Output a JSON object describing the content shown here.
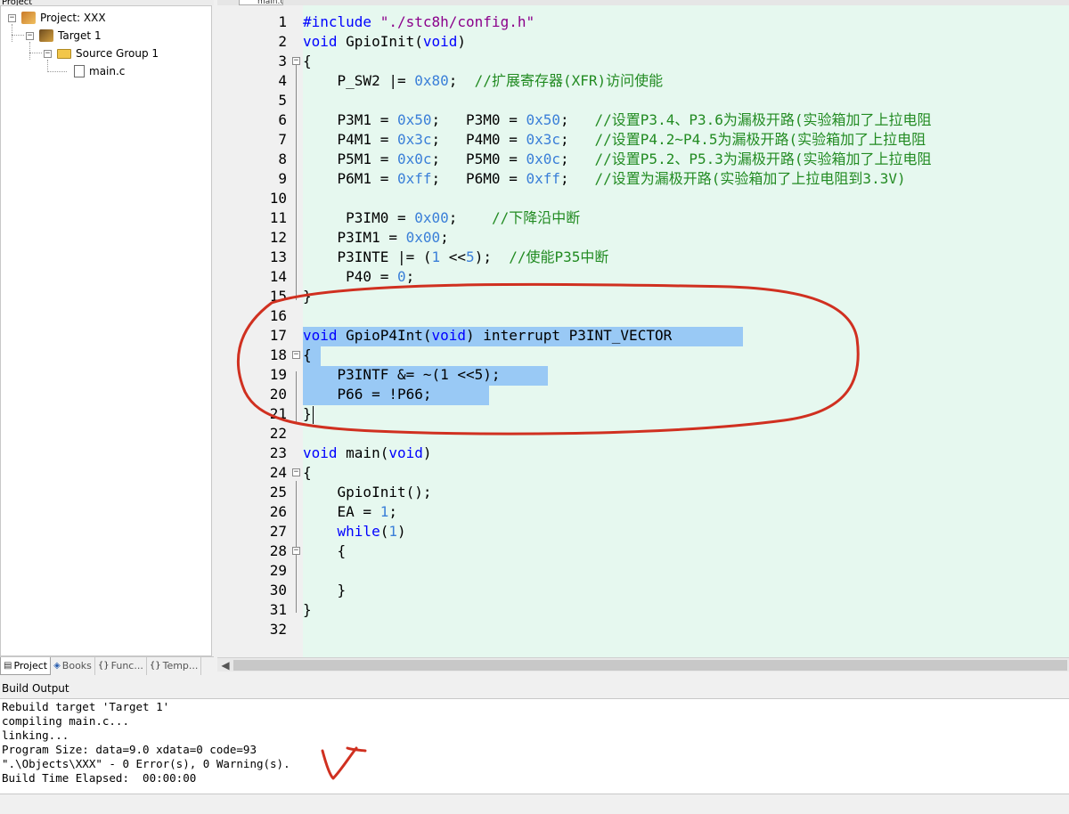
{
  "project_panel": {
    "header": "Project",
    "tree": {
      "project": "Project: XXX",
      "target": "Target 1",
      "group": "Source Group 1",
      "file": "main.c"
    },
    "tabs": [
      {
        "label": "Project",
        "icon": "project-icon"
      },
      {
        "label": "Books",
        "icon": "books-icon"
      },
      {
        "label": "Func...",
        "icon": "functions-icon"
      },
      {
        "label": "Temp...",
        "icon": "templates-icon"
      }
    ]
  },
  "editor": {
    "tab_label": "main.c",
    "lines": [
      {
        "n": "1"
      },
      {
        "n": "2"
      },
      {
        "n": "3"
      },
      {
        "n": "4"
      },
      {
        "n": "5"
      },
      {
        "n": "6"
      },
      {
        "n": "7"
      },
      {
        "n": "8"
      },
      {
        "n": "9"
      },
      {
        "n": "10"
      },
      {
        "n": "11"
      },
      {
        "n": "12"
      },
      {
        "n": "13"
      },
      {
        "n": "14"
      },
      {
        "n": "15"
      },
      {
        "n": "16"
      },
      {
        "n": "17"
      },
      {
        "n": "18"
      },
      {
        "n": "19"
      },
      {
        "n": "20"
      },
      {
        "n": "21"
      },
      {
        "n": "22"
      },
      {
        "n": "23"
      },
      {
        "n": "24"
      },
      {
        "n": "25"
      },
      {
        "n": "26"
      },
      {
        "n": "27"
      },
      {
        "n": "28"
      },
      {
        "n": "29"
      },
      {
        "n": "30"
      },
      {
        "n": "31"
      },
      {
        "n": "32"
      }
    ],
    "code": {
      "l1a": "#include ",
      "l1b": "\"./stc8h/config.h\"",
      "l2a": "void",
      "l2b": " GpioInit(",
      "l2c": "void",
      "l2d": ")",
      "l3": "{",
      "l4a": "    P_SW2 |= ",
      "l4b": "0x80",
      "l4c": ";  ",
      "l4d": "//扩展寄存器(XFR)访问使能",
      "l6a": "    P3M1 = ",
      "l6b": "0x50",
      "l6c": ";   P3M0 = ",
      "l6d": "0x50",
      "l6e": ";   ",
      "l6f": "//设置P3.4、P3.6为漏极开路(实验箱加了上拉电阻",
      "l7a": "    P4M1 = ",
      "l7b": "0x3c",
      "l7c": ";   P4M0 = ",
      "l7d": "0x3c",
      "l7e": ";   ",
      "l7f": "//设置P4.2~P4.5为漏极开路(实验箱加了上拉电阻",
      "l8a": "    P5M1 = ",
      "l8b": "0x0c",
      "l8c": ";   P5M0 = ",
      "l8d": "0x0c",
      "l8e": ";   ",
      "l8f": "//设置P5.2、P5.3为漏极开路(实验箱加了上拉电阻",
      "l9a": "    P6M1 = ",
      "l9b": "0xff",
      "l9c": ";   P6M0 = ",
      "l9d": "0xff",
      "l9e": ";   ",
      "l9f": "//设置为漏极开路(实验箱加了上拉电阻到3.3V)",
      "l11a": "     P3IM0 = ",
      "l11b": "0x00",
      "l11c": ";    ",
      "l11d": "//下降沿中断",
      "l12a": "    P3IM1 = ",
      "l12b": "0x00",
      "l12c": ";",
      "l13a": "    P3INTE |= (",
      "l13b": "1",
      "l13c": " <<",
      "l13d": "5",
      "l13e": ");  ",
      "l13f": "//使能P35中断",
      "l14a": "     P40 = ",
      "l14b": "0",
      "l14c": ";",
      "l15": "}",
      "l17a": "void",
      "l17b": " GpioP4Int(",
      "l17c": "void",
      "l17d": ") interrupt P3INT_VECTOR",
      "l18": "{",
      "l19": "    P3INTF &= ~(1 <<5);",
      "l20": "    P66 = !P66;",
      "l21": "}",
      "l23a": "void",
      "l23b": " main(",
      "l23c": "void",
      "l23d": ")",
      "l24": "{",
      "l25": "    GpioInit();",
      "l26a": "    EA = ",
      "l26b": "1",
      "l26c": ";",
      "l27a": "    ",
      "l27b": "while",
      "l27c": "(",
      "l27d": "1",
      "l27e": ")",
      "l28": "    {",
      "l30": "    }",
      "l31": "}"
    }
  },
  "build_output": {
    "title": "Build Output",
    "lines": [
      "Rebuild target 'Target 1'",
      "compiling main.c...",
      "linking...",
      "Program Size: data=9.0 xdata=0 code=93",
      "\".\\Objects\\XXX\" - 0 Error(s), 0 Warning(s).",
      "Build Time Elapsed:  00:00:00"
    ]
  },
  "colors": {
    "editor_bg": "#e6f8ef",
    "selection": "#99c9f5",
    "keyword": "#0000ff",
    "number": "#3a7fd8",
    "comment": "#228b22",
    "string": "#8b008b",
    "annotation": "#d03020"
  }
}
